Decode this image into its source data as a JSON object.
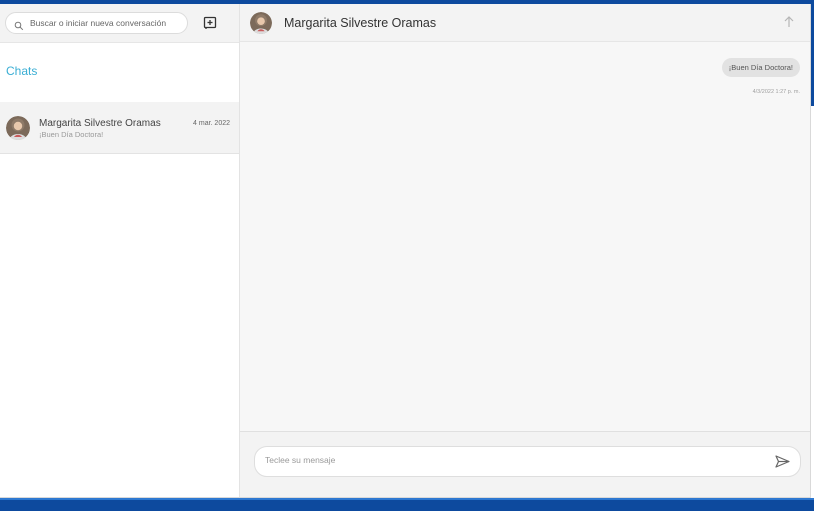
{
  "sidebar": {
    "search": {
      "placeholder": "Buscar o iniciar nueva conversación",
      "icon": "search-icon"
    },
    "new_chat_icon": "new-chat-icon",
    "title": "Chats",
    "chats": [
      {
        "name": "Margarita Silvestre Oramas",
        "date": "4 mar. 2022",
        "preview": "¡Buen Día Doctora!",
        "avatar": "contact-avatar"
      }
    ]
  },
  "conversation": {
    "header": {
      "name": "Margarita Silvestre Oramas",
      "avatar": "contact-avatar",
      "action_icon": "arrow-up-icon"
    },
    "messages": [
      {
        "text": "¡Buen Día Doctora!",
        "timestamp": "4/3/2022 1:27 p. m."
      }
    ],
    "composer": {
      "placeholder": "Teclee su mensaje",
      "send_icon": "send-icon"
    }
  },
  "colors": {
    "frame_blue": "#0d4a9e",
    "accent": "#3aaed4",
    "bubble": "#e2e2e2",
    "panel": "#f3f3f3"
  }
}
